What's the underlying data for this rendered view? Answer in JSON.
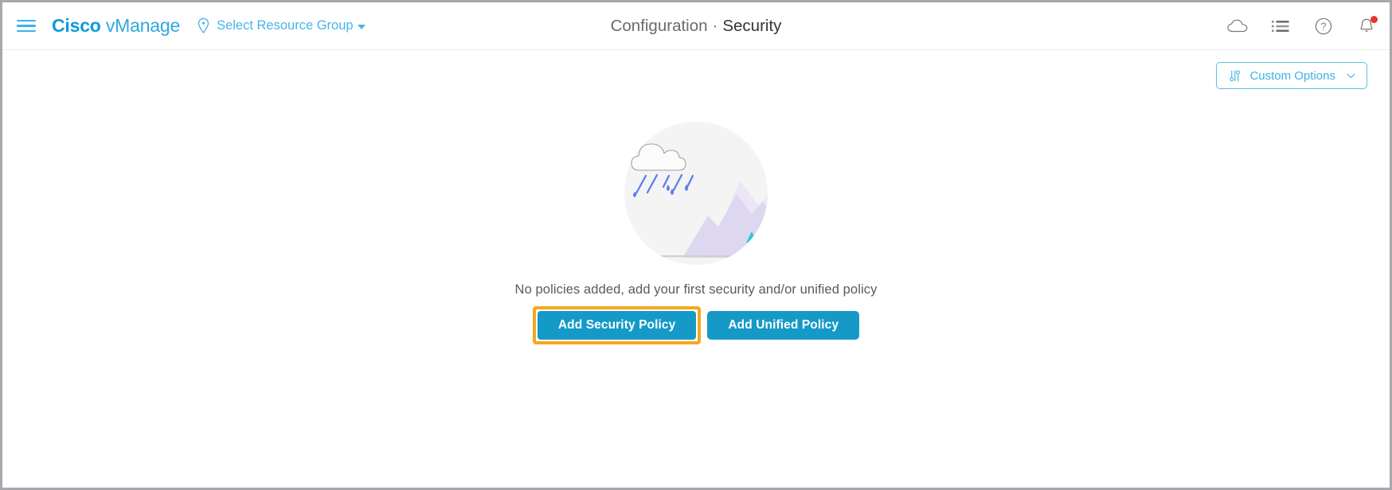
{
  "window": {
    "border_color": "#a6a8ab"
  },
  "header": {
    "menu_icon": "hamburger-menu-icon",
    "brand_primary": "Cisco",
    "brand_secondary": "vManage",
    "resource_group": {
      "icon": "location-pin-icon",
      "label": "Select Resource Group",
      "caret": "caret-down-icon"
    },
    "title": {
      "section": "Configuration",
      "separator": "·",
      "page": "Security"
    },
    "actions": [
      {
        "name": "cloud-icon",
        "label": "Cloud"
      },
      {
        "name": "list-icon",
        "label": "Tasks"
      },
      {
        "name": "help-icon",
        "label": "Help"
      },
      {
        "name": "bell-icon",
        "label": "Alarms",
        "badge": true,
        "badge_color": "#e8342a"
      }
    ]
  },
  "toolbar": {
    "custom_options": {
      "icon": "sliders-icon",
      "label": "Custom Options",
      "chevron": "chevron-down-icon"
    }
  },
  "main": {
    "illustration": {
      "name": "rain-cloud-mountains-illustration",
      "circle_color": "#f4f4f5",
      "cloud_stroke": "#9a9a9a",
      "raindrop_color": "#5d7fe8",
      "mountain_color": "#ddd8ef",
      "mountain_color_light": "#eae6f6",
      "tree_color": "#2ec8cf",
      "ground_color": "#cfcfd4"
    },
    "empty_message": "No policies added, add your first security and/or unified policy",
    "buttons": [
      {
        "name": "add-security-policy-button",
        "label": "Add Security Policy",
        "color": "#159ac8",
        "highlighted": true,
        "highlight_color": "#f5a81c"
      },
      {
        "name": "add-unified-policy-button",
        "label": "Add Unified Policy",
        "color": "#159ac8",
        "highlighted": false
      }
    ]
  },
  "colors": {
    "brand_blue": "#0d9bd8",
    "accent_blue": "#3fb0e4",
    "primary_button": "#159ac8",
    "highlight_orange": "#f5a81c",
    "alert_red": "#e8342a"
  }
}
